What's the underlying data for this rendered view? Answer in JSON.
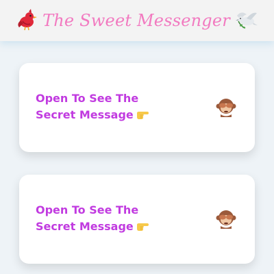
{
  "header": {
    "title": "The Sweet Messenger",
    "left_icon": "red-bird-icon",
    "right_icon": "dove-icon"
  },
  "cards": [
    {
      "label": "Open To See The Secret Message",
      "pointer_icon": "pointing-hand-icon",
      "status_icon": "see-no-evil-monkey-icon"
    },
    {
      "label": "Open To See The Secret Message",
      "pointer_icon": "pointing-hand-icon",
      "status_icon": "see-no-evil-monkey-icon"
    }
  ],
  "colors": {
    "title": "#f27ac0",
    "card_text": "#c13be0",
    "background": "#eef3f7",
    "header_bg": "#f3f3f3"
  }
}
